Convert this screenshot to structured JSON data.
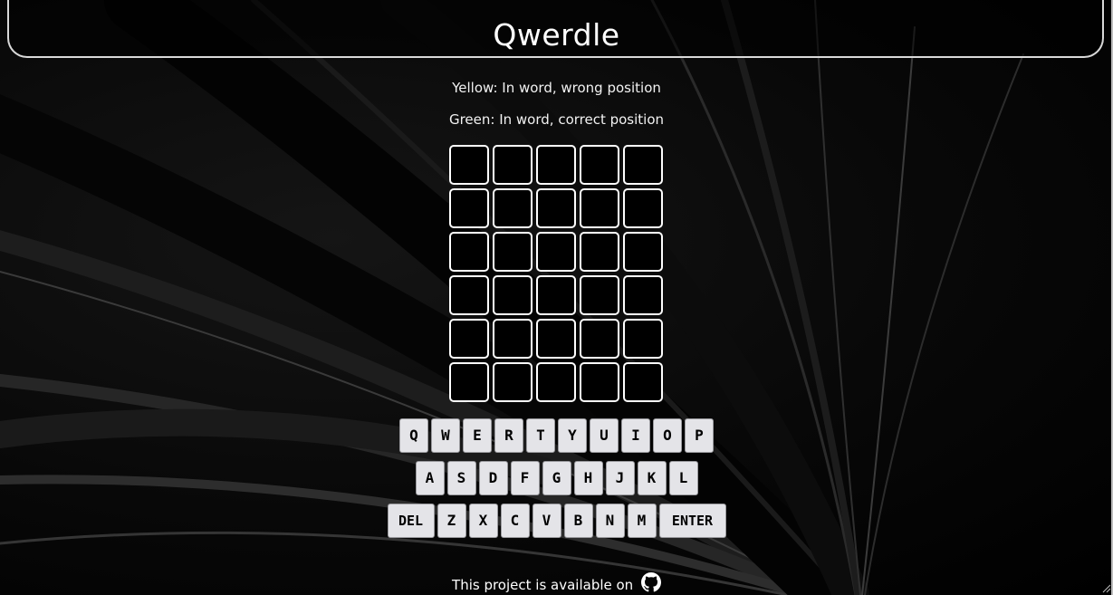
{
  "header": {
    "title": "Qwerdle"
  },
  "legend": {
    "yellow": "Yellow: In word, wrong position",
    "green": "Green: In word, correct position"
  },
  "board": {
    "rows": 6,
    "cols": 5
  },
  "keyboard": {
    "row1": [
      "Q",
      "W",
      "E",
      "R",
      "T",
      "Y",
      "U",
      "I",
      "O",
      "P"
    ],
    "row2": [
      "A",
      "S",
      "D",
      "F",
      "G",
      "H",
      "J",
      "K",
      "L"
    ],
    "row3": [
      "DEL",
      "Z",
      "X",
      "C",
      "V",
      "B",
      "N",
      "M",
      "ENTER"
    ]
  },
  "footer": {
    "text": "This project is available on",
    "link_icon": "github-icon"
  },
  "colors": {
    "background": "#000000",
    "tile_border": "#ffffff",
    "key_bg": "#e4e4e8",
    "header_border": "#d9d9d9"
  }
}
